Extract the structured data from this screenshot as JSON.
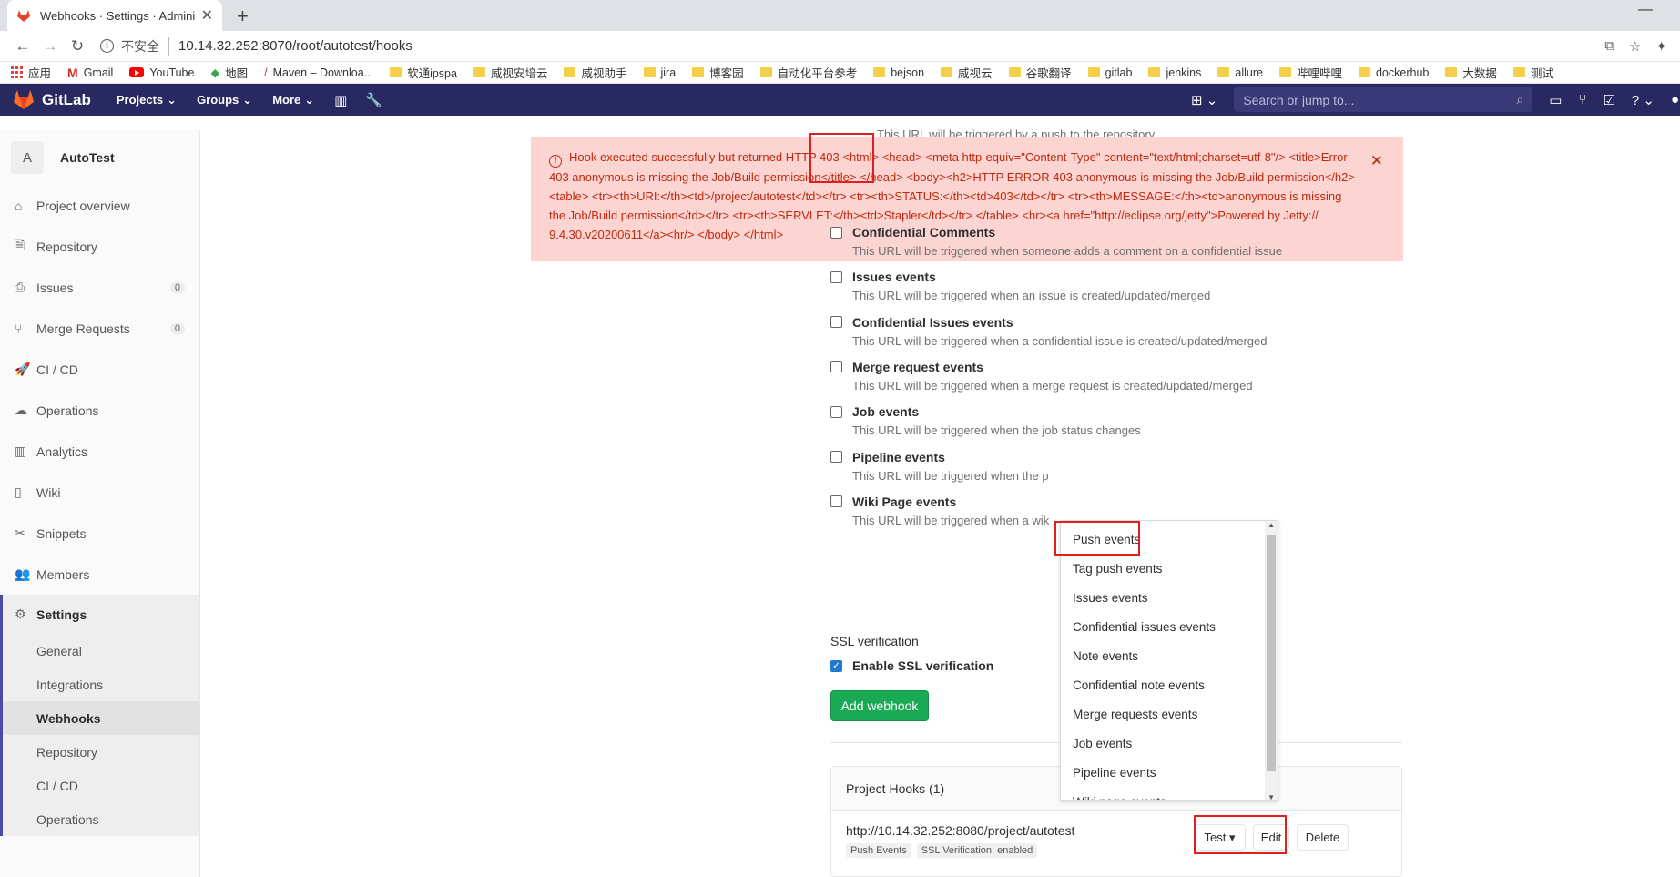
{
  "browser": {
    "tab_title": "Webhooks · Settings · Admini",
    "new_tab": "+",
    "security_label": "不安全",
    "url": "10.14.32.252:8070/root/autotest/hooks",
    "bookmarks": [
      "应用",
      "Gmail",
      "YouTube",
      "地图",
      "Maven – Downloa...",
      "软通ipspa",
      "威视安培云",
      "威视助手",
      "jira",
      "博客园",
      "自动化平台参考",
      "bejson",
      "威视云",
      "谷歌翻译",
      "gitlab",
      "jenkins",
      "allure",
      "哔哩哔哩",
      "dockerhub",
      "大数据",
      "测试"
    ]
  },
  "header": {
    "brand": "GitLab",
    "nav": [
      "Projects",
      "Groups",
      "More"
    ],
    "search_placeholder": "Search or jump to..."
  },
  "sidebar": {
    "avatar_letter": "A",
    "project_name": "AutoTest",
    "items": [
      {
        "label": "Project overview",
        "icon": "home-icon",
        "glyph": "⌂"
      },
      {
        "label": "Repository",
        "icon": "doc-icon",
        "glyph": "🗎"
      },
      {
        "label": "Issues",
        "icon": "issues-icon",
        "glyph": "⎙",
        "badge": "0"
      },
      {
        "label": "Merge Requests",
        "icon": "merge-icon",
        "glyph": "⑂",
        "badge": "0"
      },
      {
        "label": "CI / CD",
        "icon": "rocket-icon",
        "glyph": "🚀"
      },
      {
        "label": "Operations",
        "icon": "cloud-icon",
        "glyph": "☁"
      },
      {
        "label": "Analytics",
        "icon": "chart-icon",
        "glyph": "▥"
      },
      {
        "label": "Wiki",
        "icon": "book-icon",
        "glyph": "▯"
      },
      {
        "label": "Snippets",
        "icon": "scissors-icon",
        "glyph": "✂"
      },
      {
        "label": "Members",
        "icon": "users-icon",
        "glyph": "👥"
      }
    ],
    "settings_label": "Settings",
    "sub_items": [
      "General",
      "Integrations",
      "Webhooks",
      "Repository",
      "CI / CD",
      "Operations"
    ]
  },
  "flash": {
    "peek_text": "This URL will be triggered by a push to the repository",
    "message": "Hook executed successfully but returned HTTP 403 <html> <head> <meta http-equiv=\"Content-Type\" content=\"text/html;charset=utf-8\"/> <title>Error 403 anonymous is missing the Job/Build permission</title> </head> <body><h2>HTTP ERROR 403 anonymous is missing the Job/Build permission</h2> <table> <tr><th>URI:</th><td>/project/autotest</td></tr> <tr><th>STATUS:</th><td>403</td></tr> <tr><th>MESSAGE:</th><td>anonymous is missing the Job/Build permission</td></tr> <tr><th>SERVLET:</th><td>Stapler</td></tr> </table> <hr><a href=\"http://eclipse.org/jetty\">Powered by Jetty:// 9.4.30.v20200611</a><hr/> </body> </html>"
  },
  "options": [
    {
      "label": "Confidential Comments",
      "desc": "This URL will be triggered when someone adds a comment on a confidential issue"
    },
    {
      "label": "Issues events",
      "desc": "This URL will be triggered when an issue is created/updated/merged"
    },
    {
      "label": "Confidential Issues events",
      "desc": "This URL will be triggered when a confidential issue is created/updated/merged"
    },
    {
      "label": "Merge request events",
      "desc": "This URL will be triggered when a merge request is created/updated/merged"
    },
    {
      "label": "Job events",
      "desc": "This URL will be triggered when the job status changes"
    },
    {
      "label": "Pipeline events",
      "desc": "This URL will be triggered when the p"
    },
    {
      "label": "Wiki Page events",
      "desc": "This URL will be triggered when a wik"
    }
  ],
  "ssl": {
    "section_label": "SSL verification",
    "checkbox_label": "Enable SSL verification",
    "checked": true
  },
  "add_webhook_label": "Add webhook",
  "hooks": {
    "header": "Project Hooks (1)",
    "url": "http://10.14.32.252:8080/project/autotest",
    "tags": [
      "Push Events",
      "SSL Verification: enabled"
    ],
    "test_label": "Test",
    "edit_label": "Edit",
    "delete_label": "Delete"
  },
  "test_dropdown": [
    "Push events",
    "Tag push events",
    "Issues events",
    "Confidential issues events",
    "Note events",
    "Confidential note events",
    "Merge requests events",
    "Job events",
    "Pipeline events",
    "Wiki page events"
  ],
  "colors": {
    "gitlab_header": "#292961",
    "flash_bg": "#fcd5d2",
    "flash_text": "#c1280d",
    "add_button": "#1aaa55",
    "highlight_box": "#e02020"
  }
}
